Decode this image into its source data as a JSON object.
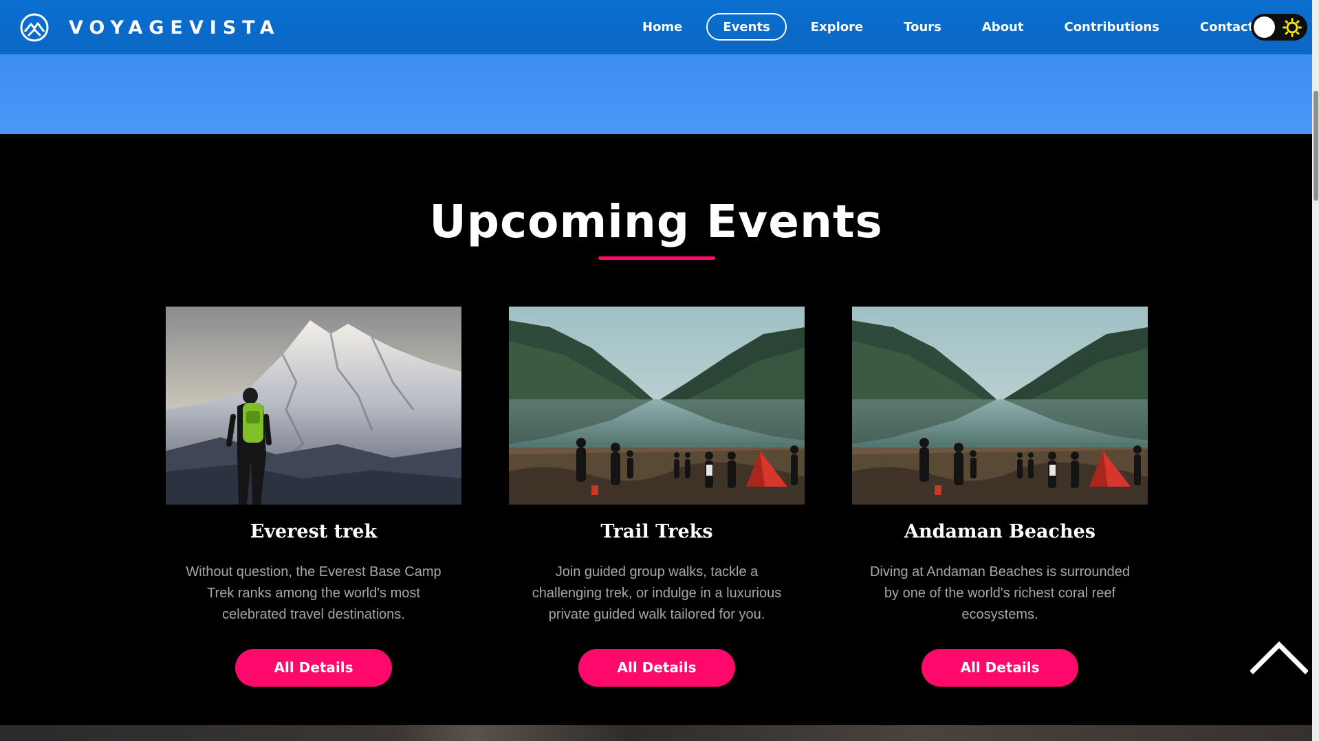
{
  "brand": {
    "name": "VOYAGEVISTA",
    "logo_icon": "mountain-logo-icon"
  },
  "nav": {
    "items": [
      {
        "label": "Home",
        "active": false
      },
      {
        "label": "Events",
        "active": true
      },
      {
        "label": "Explore",
        "active": false
      },
      {
        "label": "Tours",
        "active": false
      },
      {
        "label": "About",
        "active": false
      },
      {
        "label": "Contributions",
        "active": false
      },
      {
        "label": "Contact",
        "active": false
      }
    ],
    "theme_toggle": {
      "icon": "sun-icon",
      "state": "light"
    }
  },
  "events": {
    "title": "Upcoming Events",
    "cards": [
      {
        "title": "Everest trek",
        "text": "Without question, the Everest Base Camp Trek ranks among the world's most celebrated travel destinations.",
        "button": "All Details",
        "image": "hiker-mountain-image"
      },
      {
        "title": "Trail Treks",
        "text": "Join guided group walks, tackle a challenging trek, or indulge in a luxurious private guided walk tailored for you.",
        "button": "All Details",
        "image": "lake-camp-image"
      },
      {
        "title": "Andaman Beaches",
        "text": "Diving at Andaman Beaches is surrounded by one of the world's richest coral reef ecosystems.",
        "button": "All Details",
        "image": "lake-camp-image"
      }
    ]
  },
  "scroll_top": {
    "icon": "chevron-up-icon"
  },
  "colors": {
    "nav_bg": "#0a6fd0",
    "hero": "#4a97f7",
    "accent": "#ff0a6c",
    "background": "#000000"
  }
}
